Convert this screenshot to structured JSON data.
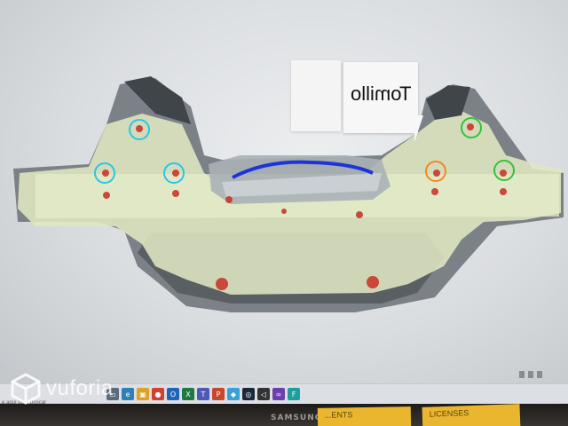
{
  "scene": {
    "callout": {
      "label": "Tomillo"
    },
    "watermark": {
      "label": "vuforia",
      "icon": "vuforia-cube-icon"
    },
    "monitor_brand": "SAMSUNG",
    "sticky_notes": [
      "...ENTS",
      "LICENSES"
    ],
    "taskbar": {
      "search_placeholder": "e aquí para buscar",
      "icons": [
        "file-explorer-icon",
        "edge-icon",
        "chrome-icon",
        "folder-icon",
        "outlook-icon",
        "excel-icon",
        "teams-icon",
        "powerpoint-icon",
        "paint-icon",
        "steam-icon",
        "unity-icon",
        "visual-studio-icon",
        "vuforia-studio-icon"
      ]
    },
    "markers": {
      "colors": {
        "cyan": "#27c8e6",
        "orange": "#f08a1c",
        "green": "#33c23a",
        "bolt": "#c8382c",
        "path": "#1d35d6"
      }
    }
  }
}
